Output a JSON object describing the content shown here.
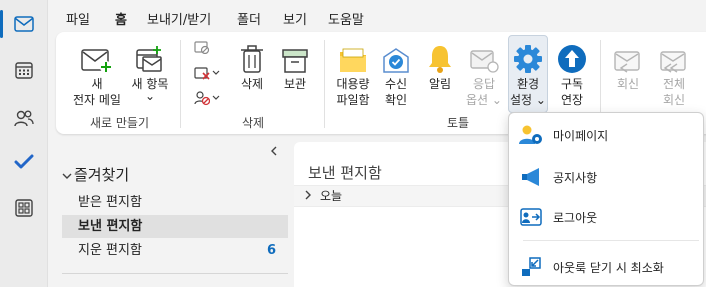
{
  "menu": {
    "tabs": [
      "파일",
      "홈",
      "보내기/받기",
      "폴더",
      "보기",
      "도움말"
    ],
    "active": "홈"
  },
  "rail": {
    "items": [
      "mail",
      "calendar",
      "people",
      "todo",
      "apps"
    ]
  },
  "ribbon": {
    "new_group": {
      "label": "새로 만들기",
      "new_mail": [
        "새",
        "전자 메일"
      ],
      "new_items": [
        "새 항목",
        "⌄"
      ]
    },
    "delete_group": {
      "label": "삭제",
      "delete": "삭제",
      "archive": "보관"
    },
    "tools_group": {
      "label": "토틀",
      "large_mail": [
        "대용량",
        "파일함"
      ],
      "read_receipt": [
        "수신",
        "확인"
      ],
      "alerts": "알림",
      "reply_options": [
        "응답",
        "옵션 ⌄"
      ],
      "env_settings": [
        "환경",
        "설정 ⌄"
      ],
      "subscription": [
        "구독",
        "연장"
      ]
    },
    "respond_group": {
      "reply": "회신",
      "reply_all": [
        "전체",
        "회신"
      ]
    }
  },
  "folders": {
    "favorites_label": "즐겨찾기",
    "items": [
      {
        "name": "받은 편지함",
        "count": "",
        "selected": false
      },
      {
        "name": "보낸 편지함",
        "count": "",
        "selected": true
      },
      {
        "name": "지운 편지함",
        "count": "6",
        "selected": false
      }
    ]
  },
  "message_list": {
    "title": "보낸 편지함",
    "group": "오늘"
  },
  "dropdown": {
    "items": [
      {
        "label": "마이페이지",
        "icon": "person-gear-icon"
      },
      {
        "label": "공지사항",
        "icon": "megaphone-icon"
      },
      {
        "label": "로그아웃",
        "icon": "sign-out-icon"
      },
      {
        "label": "아웃룩 닫기 시 최소화",
        "icon": "minimize-icon"
      }
    ]
  },
  "colors": {
    "accent": "#0f6cbd",
    "warning": "#f7c331",
    "rail_bg": "#ebebeb"
  }
}
